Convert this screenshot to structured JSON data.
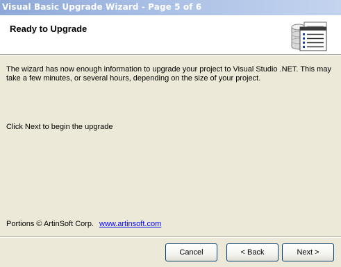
{
  "window": {
    "title": "Visual Basic Upgrade Wizard - Page 5 of 6"
  },
  "header": {
    "title": "Ready to Upgrade",
    "icon": "database-document-icon"
  },
  "content": {
    "description": "The wizard has now enough information to upgrade your project to Visual Studio .NET. This may take a few minutes, or several hours, depending on the size of your project.",
    "instruction": "Click Next to begin the upgrade"
  },
  "footer": {
    "copyright": "Portions © ArtinSoft Corp.",
    "link": "www.artinsoft.com"
  },
  "buttons": {
    "cancel": "Cancel",
    "back": "< Back",
    "next": "Next >"
  }
}
